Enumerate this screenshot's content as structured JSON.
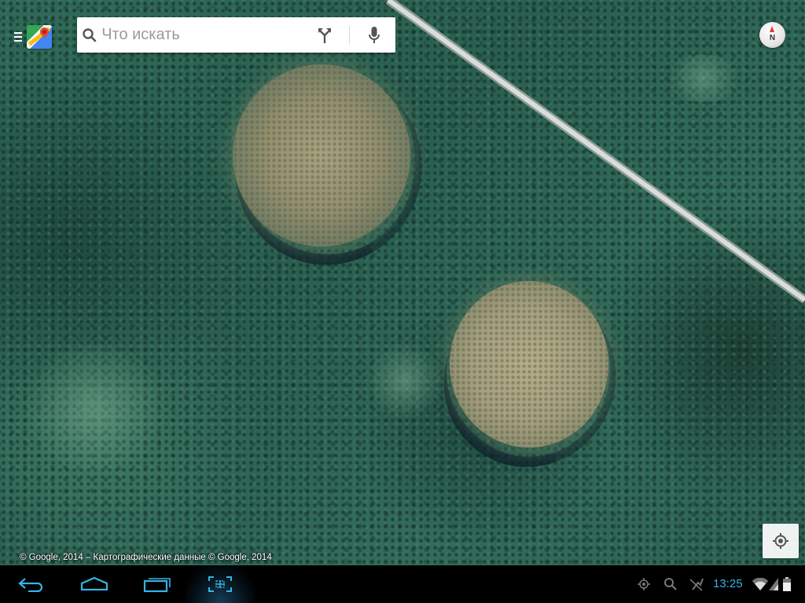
{
  "search": {
    "placeholder": "Что искать"
  },
  "compass": {
    "label": "N"
  },
  "attribution": {
    "text": "© Google, 2014 – Картографические данные © Google, 2014"
  },
  "status_bar": {
    "time": "13:25"
  },
  "icons": {
    "menu": "hamburger-icon",
    "logo": "google-maps-icon",
    "search": "search-icon",
    "directions": "directions-icon",
    "voice": "microphone-icon",
    "compass": "compass-icon",
    "locate": "my-location-icon",
    "back": "back-icon",
    "home": "home-icon",
    "recents": "recent-apps-icon",
    "screenshot": "screenshot-icon",
    "gps": "gps-icon",
    "status_search": "search-icon",
    "sync": "sync-off-icon",
    "wifi": "wifi-icon",
    "signal": "signal-icon",
    "battery": "battery-icon"
  },
  "colors": {
    "clock": "#33b5e5",
    "system_bar": "#000000",
    "forest": "#2f6a58",
    "clearing": "#a9a27f"
  }
}
